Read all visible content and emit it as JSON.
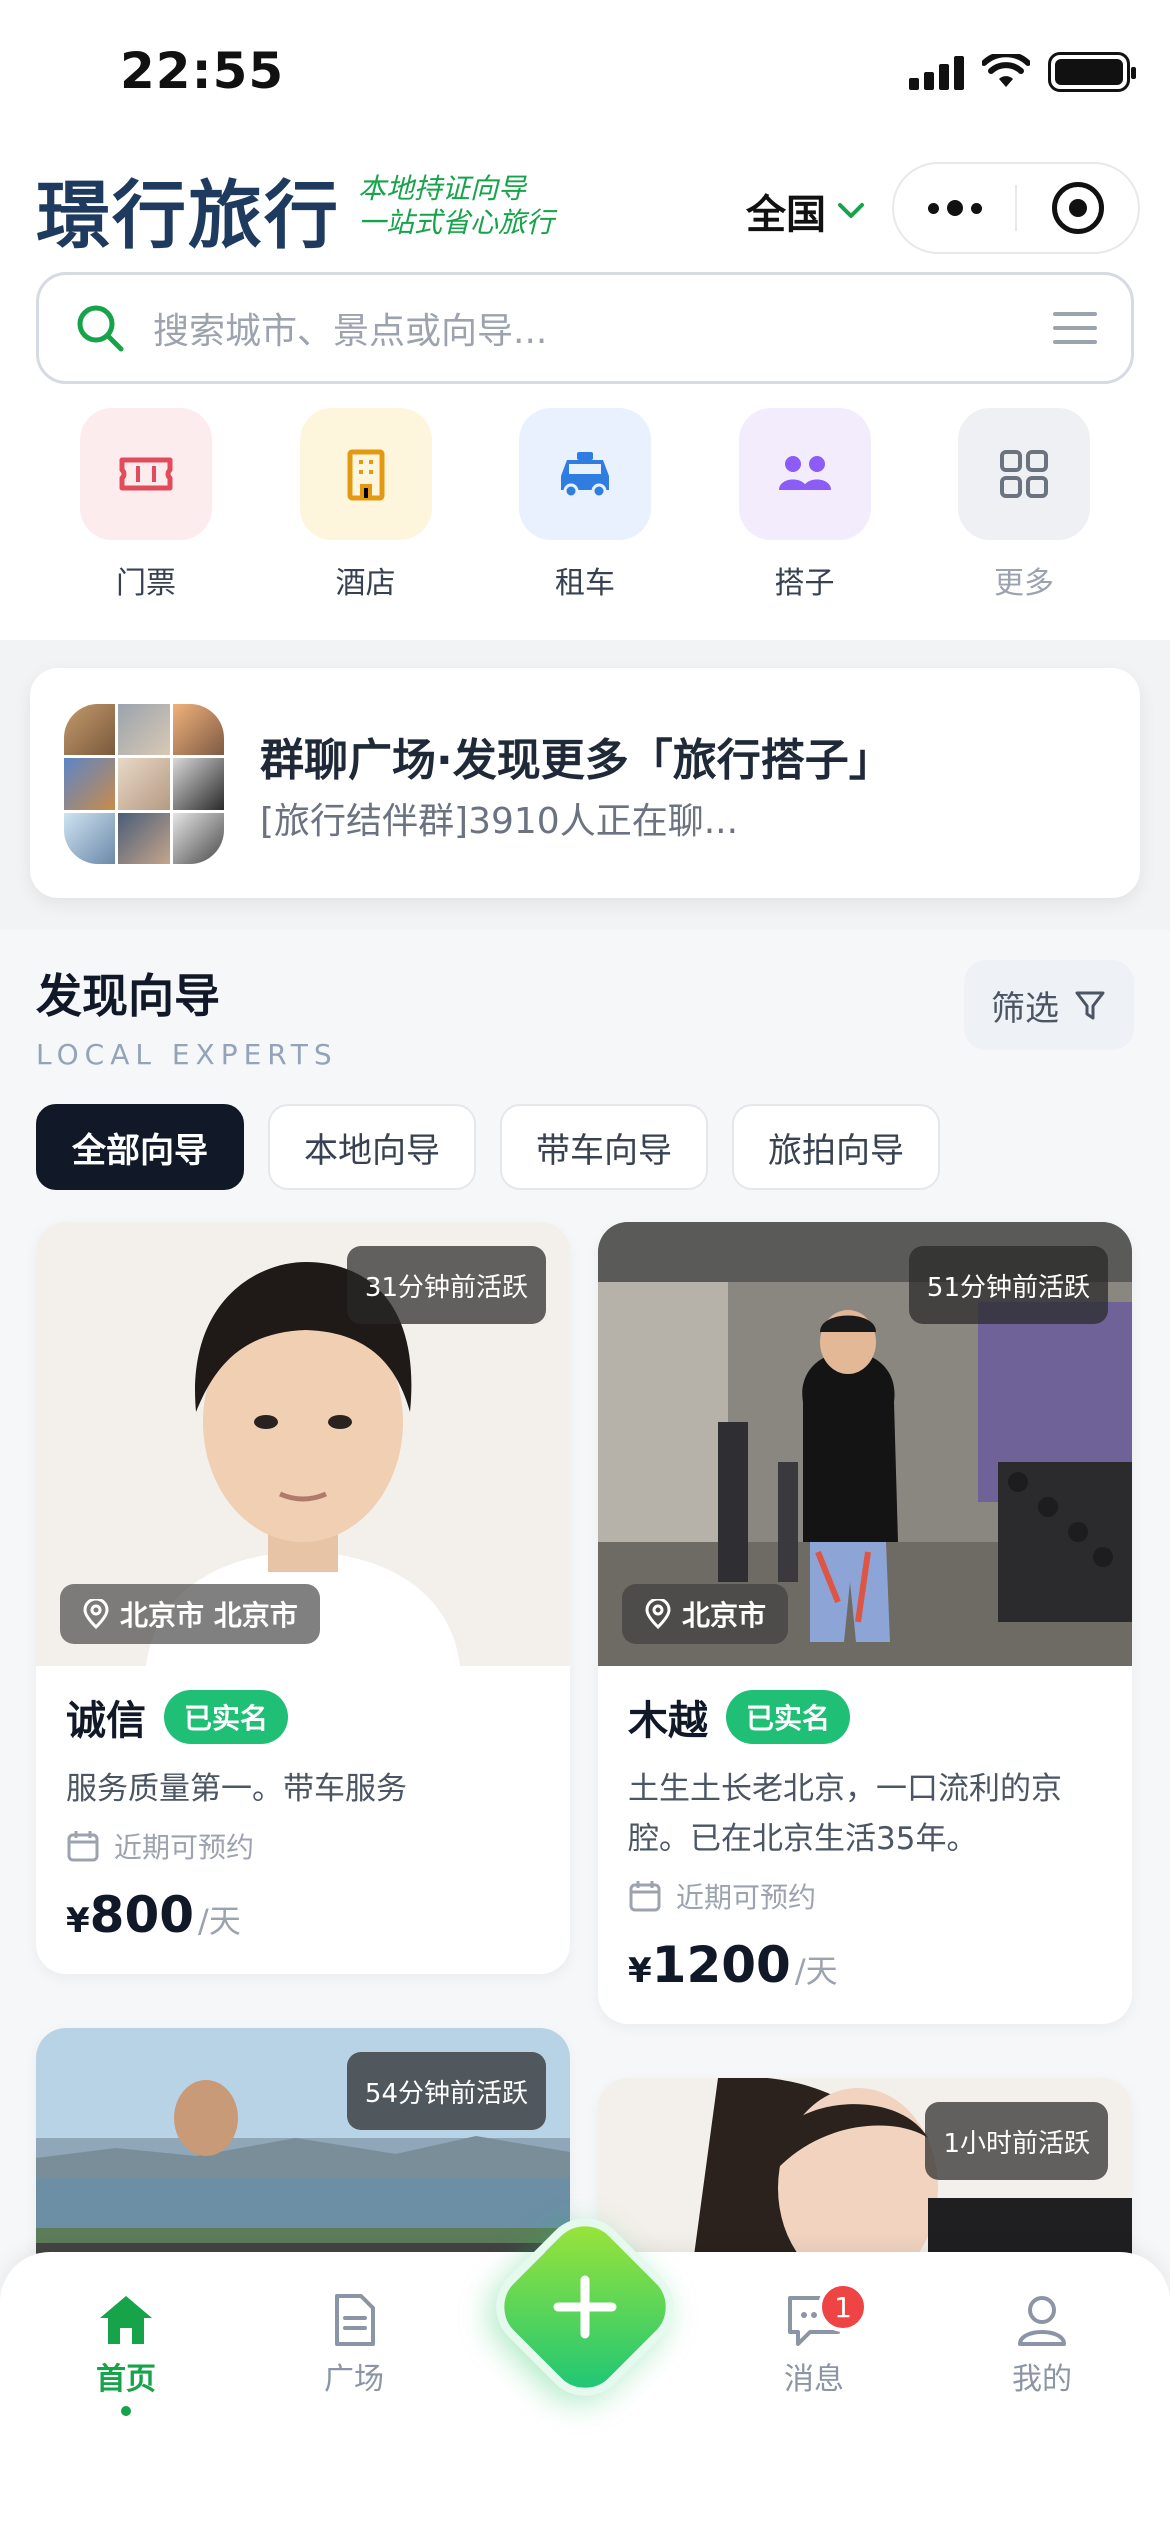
{
  "status_bar": {
    "time": "22:55"
  },
  "header": {
    "brand": "璟行旅行",
    "slogan_line1": "本地持证向导",
    "slogan_line2": "一站式省心旅行",
    "region": "全国"
  },
  "search": {
    "placeholder": "搜索城市、景点或向导..."
  },
  "quick_nav": [
    {
      "label": "门票",
      "icon": "ticket-icon",
      "bg": "#fdecee",
      "color": "#e24b5a"
    },
    {
      "label": "酒店",
      "icon": "hotel-icon",
      "bg": "#fdf6dd",
      "color": "#e39a12"
    },
    {
      "label": "租车",
      "icon": "car-icon",
      "bg": "#e8f1fd",
      "color": "#2f7de1"
    },
    {
      "label": "搭子",
      "icon": "people-icon",
      "bg": "#f3ecfd",
      "color": "#8b5cf6"
    },
    {
      "label": "更多",
      "icon": "grid-icon",
      "bg": "#eef0f3",
      "color": "#6b7280"
    }
  ],
  "group_chat": {
    "title": "群聊广场·发现更多「旅行搭子」",
    "subtitle": "[旅行结伴群]3910人正在聊..."
  },
  "section": {
    "title": "发现向导",
    "subtitle": "LOCAL EXPERTS",
    "filter_label": "筛选",
    "tabs": [
      "全部向导",
      "本地向导",
      "带车向导",
      "旅拍向导"
    ]
  },
  "guides": [
    {
      "active": "31分钟前活跃",
      "location": "北京市 北京市",
      "name": "诚信",
      "verified": "已实名",
      "desc": "服务质量第一。带车服务",
      "availability": "近期可预约",
      "currency": "¥",
      "price": "800",
      "unit": "/天"
    },
    {
      "active": "51分钟前活跃",
      "location": "北京市",
      "name": "木越",
      "verified": "已实名",
      "desc": "土生土长老北京，一口流利的京腔。已在北京生活35年。",
      "availability": "近期可预约",
      "currency": "¥",
      "price": "1200",
      "unit": "/天"
    },
    {
      "active": "54分钟前活跃"
    },
    {
      "active": "1小时前活跃"
    }
  ],
  "tabbar": {
    "home": "首页",
    "square": "广场",
    "messages": "消息",
    "messages_badge": "1",
    "mine": "我的"
  },
  "colors": {
    "accent": "#16a34a",
    "brand": "#1e3a5f",
    "verified": "#1fbf75"
  }
}
